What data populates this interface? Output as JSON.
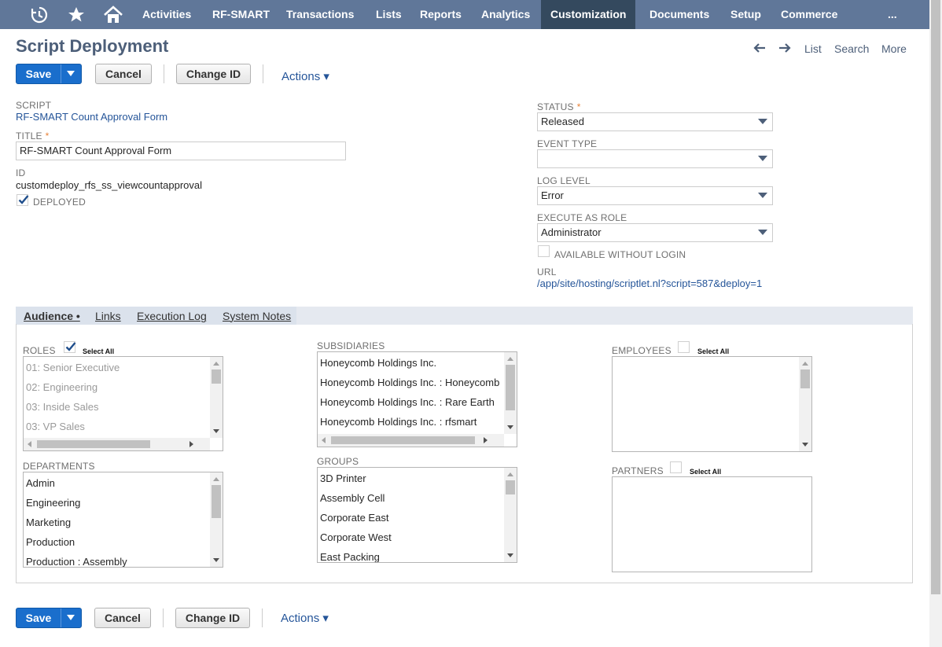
{
  "nav": {
    "items": [
      "Activities",
      "RF-SMART",
      "Transactions",
      "Lists",
      "Reports",
      "Analytics",
      "Customization",
      "Documents",
      "Setup",
      "Commerce",
      "..."
    ],
    "active": "Customization",
    "icons": [
      "recent-icon",
      "star-icon",
      "home-icon"
    ],
    "bg_color": "#607799",
    "active_color": "#34495e"
  },
  "header": {
    "title": "Script Deployment",
    "links": [
      "List",
      "Search",
      "More"
    ]
  },
  "toolbar": {
    "save": "Save",
    "cancel": "Cancel",
    "change_id": "Change ID",
    "actions": "Actions ▾"
  },
  "fields": {
    "script_label": "SCRIPT",
    "script_value": "RF-SMART Count Approval Form",
    "title_label": "TITLE",
    "title_value": "RF-SMART Count Approval Form",
    "required_mark": "*",
    "id_label": "ID",
    "id_value": "customdeploy_rfs_ss_viewcountapproval",
    "deployed_label": "DEPLOYED",
    "deployed_checked": true,
    "status_label": "STATUS",
    "status_value": "Released",
    "event_type_label": "EVENT TYPE",
    "event_type_value": "",
    "log_level_label": "LOG LEVEL",
    "log_level_value": "Error",
    "execute_as_role_label": "EXECUTE AS ROLE",
    "execute_as_role_value": "Administrator",
    "available_without_login_label": "AVAILABLE WITHOUT LOGIN",
    "available_without_login_checked": false,
    "url_label": "URL",
    "url_value": "/app/site/hosting/scriptlet.nl?script=587&deploy=1"
  },
  "tabs": [
    "Audience •",
    "Links",
    "Execution Log",
    "System Notes"
  ],
  "audience": {
    "select_all": "Select All",
    "roles_label": "ROLES",
    "roles_select_all_checked": true,
    "roles": [
      "01: Senior Executive",
      "02: Engineering",
      "03: Inside Sales",
      "03: VP Sales"
    ],
    "subsidiaries_label": "SUBSIDIARIES",
    "subsidiaries": [
      "Honeycomb Holdings Inc.",
      "Honeycomb Holdings Inc. : Honeycomb I",
      "Honeycomb Holdings Inc. : Rare Earth",
      "Honeycomb Holdings Inc. : rfsmart"
    ],
    "employees_label": "EMPLOYEES",
    "employees_select_all_checked": false,
    "departments_label": "DEPARTMENTS",
    "departments": [
      "Admin",
      "Engineering",
      "Marketing",
      "Production",
      "Production : Assembly"
    ],
    "groups_label": "GROUPS",
    "groups": [
      "3D Printer",
      "Assembly Cell",
      "Corporate East",
      "Corporate West",
      "East Packing"
    ],
    "partners_label": "PARTNERS",
    "partners_select_all_checked": false
  }
}
